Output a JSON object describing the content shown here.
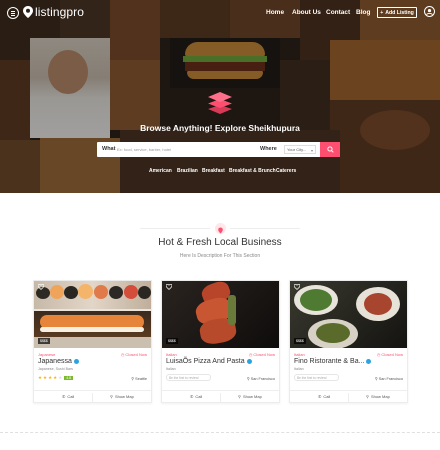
{
  "brand": {
    "name": "listingpro",
    "accent_color": "#ff4f70"
  },
  "nav": {
    "items": [
      "Home",
      "About Us",
      "Contact",
      "Blog"
    ],
    "add_listing": "Add Listing"
  },
  "hero": {
    "title": "Browse Anything! Explore Sheikhupura",
    "search": {
      "what_label": "What",
      "what_placeholder": "Ex: food, service, barber, hotel",
      "where_label": "Where",
      "city_value": "Your City...",
      "button_icon": "search-icon"
    },
    "categories": [
      "American",
      "Brazilian",
      "Breakfast",
      "Breakfast & Brunch",
      "Caterers"
    ]
  },
  "section": {
    "title": "Hot & Fresh Local Business",
    "subtitle": "Here Is Description For This Section"
  },
  "cards": [
    {
      "category": "Japanese",
      "status": "Closed Now",
      "name": "Japanessa",
      "tags": "Japanese, Sushi Bars",
      "rating": 4,
      "score": "4.8",
      "location": "Seattle",
      "call": "Call",
      "map": "Show Map",
      "badge": "$$$$"
    },
    {
      "category": "Italian",
      "status": "Closed Now",
      "name": "LuisaÕs Pizza And Pasta",
      "tags": "Italian",
      "ask": "Be the first to review!",
      "location": "San Francisco",
      "call": "Call",
      "map": "Show Map",
      "badge": "$$$$"
    },
    {
      "category": "Italian",
      "status": "Closed Now",
      "name": "Fino Ristorante & Ba...",
      "tags": "Italian",
      "ask": "Be the first to review!",
      "location": "San Francisco",
      "call": "Call",
      "map": "Show Map",
      "badge": "$$$$"
    }
  ]
}
